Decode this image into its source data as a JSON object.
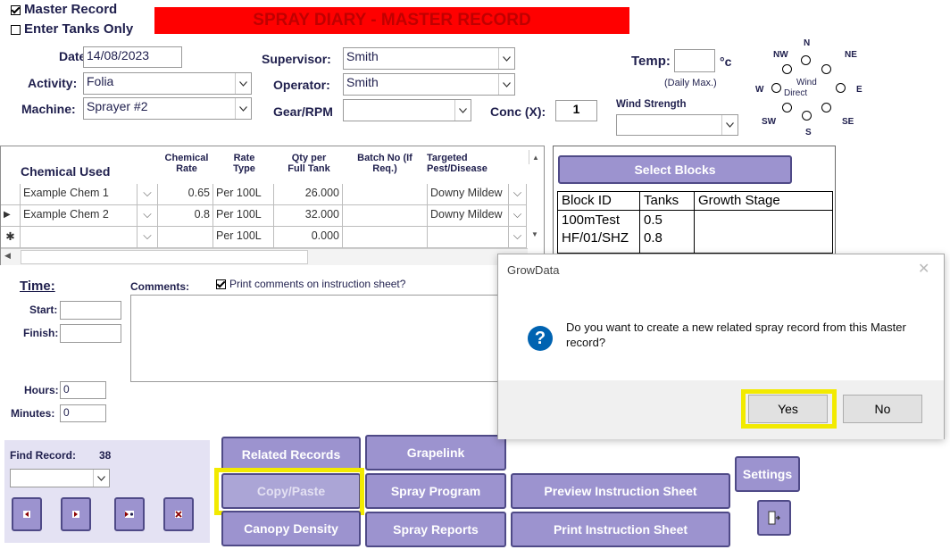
{
  "header": {
    "master_record_label": "Master Record",
    "enter_tanks_label": "Enter Tanks Only",
    "banner_title": "SPRAY DIARY - MASTER RECORD"
  },
  "form": {
    "date_label": "Date:",
    "date_value": "14/08/2023",
    "activity_label": "Activity:",
    "activity_value": "Folia",
    "machine_label": "Machine:",
    "machine_value": "Sprayer #2",
    "supervisor_label": "Supervisor:",
    "supervisor_value": "Smith",
    "operator_label": "Operator:",
    "operator_value": "Smith",
    "gear_label": "Gear/RPM",
    "gear_value": "",
    "conc_label": "Conc (X):",
    "conc_value": "1",
    "temp_label": "Temp:",
    "temp_value": "",
    "temp_unit": "°c",
    "temp_note": "(Daily Max.)",
    "wind_strength_label": "Wind Strength",
    "wind_strength_value": ""
  },
  "wind": {
    "n": "N",
    "ne": "NE",
    "e": "E",
    "se": "SE",
    "s": "S",
    "sw": "SW",
    "w": "W",
    "nw": "NW",
    "center_line1": "Wind",
    "center_line2": "Direct"
  },
  "chemicals": {
    "headers": {
      "chemical": "Chemical Used",
      "rate": "Chemical Rate",
      "rate_type": "Rate Type",
      "qty": "Qty per Full Tank",
      "batch": "Batch No (If Req.)",
      "pest": "Targeted Pest/Disease"
    },
    "rows": [
      {
        "chemical": "Example Chem 1",
        "rate": "0.65",
        "rate_type": "Per 100L",
        "qty": "26.000",
        "batch": "",
        "pest": "Downy Mildew"
      },
      {
        "chemical": "Example Chem 2",
        "rate": "0.8",
        "rate_type": "Per 100L",
        "qty": "32.000",
        "batch": "",
        "pest": "Downy Mildew"
      },
      {
        "chemical": "",
        "rate": "",
        "rate_type": "Per 100L",
        "qty": "0.000",
        "batch": "",
        "pest": ""
      }
    ]
  },
  "blocks": {
    "select_label": "Select Blocks",
    "headers": {
      "id": "Block ID",
      "tanks": "Tanks",
      "stage": "Growth Stage"
    },
    "rows": [
      {
        "id": "100mTest",
        "tanks": "0.5",
        "stage": ""
      },
      {
        "id": "HF/01/SHZ",
        "tanks": "0.8",
        "stage": ""
      }
    ]
  },
  "time": {
    "title": "Time:",
    "start_label": "Start:",
    "finish_label": "Finish:",
    "hours_label": "Hours:",
    "hours_value": "0",
    "minutes_label": "Minutes:",
    "minutes_value": "0"
  },
  "comments": {
    "label": "Comments:",
    "print_label": "Print comments on instruction sheet?"
  },
  "find": {
    "label": "Find Record:",
    "value": "38"
  },
  "buttons": {
    "related": "Related Records",
    "grapelink": "Grapelink",
    "copy_paste": "Copy/Paste",
    "spray_program": "Spray Program",
    "preview": "Preview Instruction Sheet",
    "settings": "Settings",
    "canopy": "Canopy Density",
    "spray_reports": "Spray Reports",
    "print": "Print Instruction Sheet"
  },
  "dialog": {
    "title": "GrowData",
    "message": "Do you want to create a new related spray record from this Master record?",
    "yes": "Yes",
    "no": "No"
  },
  "colors": {
    "banner_bg": "#ff0000",
    "banner_text": "#c00000",
    "button_bg": "#9c93cf",
    "highlight": "#f2ea00",
    "dialog_icon": "#0063b1"
  }
}
